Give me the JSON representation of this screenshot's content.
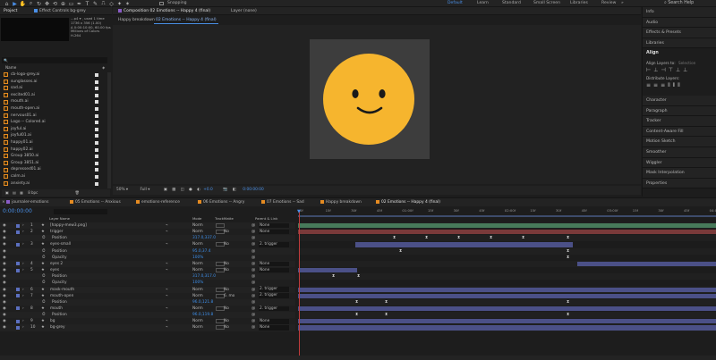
{
  "topbar": {
    "workspaces": [
      "Default",
      "Learn",
      "Standard",
      "Small Screen",
      "Libraries",
      "Review"
    ],
    "active_workspace": "Default",
    "snapping_label": "Snapping",
    "search_label": "Search Help"
  },
  "project": {
    "tab_label": "Project",
    "effect_controls_label": "Effect Controls bg-grey",
    "selected_info": [
      "...p4 ▾ , used 1 time",
      "1736 x 356 (1.00)",
      "Δ 0:00:10:00, 60.00 fps",
      "Millions of Colors",
      "H.264"
    ],
    "search_placeholder": "🔍",
    "col_name": "Name",
    "files": [
      "cb-logo-grey.ai",
      "sunglasses.ai",
      "sad.ai",
      "excited01.ai",
      "mouth.ai",
      "mouth-open.ai",
      "nervous01.ai",
      "Logo -- Colored.ai",
      "joyful.ai",
      "joyful01.ai",
      "happy01.ai",
      "happy02.ai",
      "Group 3850.ai",
      "Group 3851.ai",
      "depressed01.ai",
      "calm.ai",
      "anxiety.ai"
    ],
    "footer_label": "8 bpc"
  },
  "composition": {
    "tab_label": "Composition 02 Emotions -- Happy 4 (final)",
    "layer_tab_label": "Layer (none)",
    "sub_tabs": [
      "Happy breakdown",
      "02 Emotions -- Happy 4 (final)"
    ],
    "zoom": "50%",
    "resolution": "Full",
    "exposure": "+0.0",
    "timecode": "0:00:00:00"
  },
  "right_panel": {
    "items": [
      "Info",
      "Audio",
      "Effects & Presets",
      "Libraries"
    ],
    "align_title": "Align",
    "align_layers_to": "Align Layers to:",
    "align_target": "Selection",
    "distribute_label": "Distribute Layers:",
    "more_items": [
      "Character",
      "Paragraph",
      "Tracker",
      "Content-Aware Fill",
      "Motion Sketch",
      "Smoother",
      "Wiggler",
      "Mask Interpolation",
      "Properties"
    ]
  },
  "timeline": {
    "tabs": [
      "journaler-emotions",
      "05 Emotions -- Anxious",
      "emotions-reference",
      "06 Emotions -- Angry",
      "07 Emotions -- Sad",
      "Happy breakdown",
      "02 Emotions -- Happy 4 (final)"
    ],
    "timecode": "0:00:00:00",
    "col_layer_name": "Layer Name",
    "col_mode": "Mode",
    "col_trkmat": "TrackMatte",
    "col_parent": "Parent & Link",
    "ruler": [
      "0f",
      "15f",
      "30f",
      "45f",
      "01:00f",
      "15f",
      "30f",
      "45f",
      "02:00f",
      "15f",
      "30f",
      "45f",
      "03:00f",
      "15f",
      "30f",
      "45f",
      "04:00f"
    ],
    "layers": [
      {
        "num": "1",
        "name": "[happy-mew3.png]",
        "mode": "Norm",
        "trk": "",
        "parent": "None",
        "kind": "layer"
      },
      {
        "num": "2",
        "name": "trigger",
        "mode": "Norm",
        "trk": "No",
        "parent": "None",
        "kind": "layer"
      },
      {
        "num": "",
        "name": "Position",
        "value": "317.0,337.0",
        "kind": "prop"
      },
      {
        "num": "3",
        "name": "eyes-small",
        "mode": "Norm",
        "trk": "No",
        "parent": "2. trigger",
        "kind": "layer"
      },
      {
        "num": "",
        "name": "Position",
        "value": "95.0,37.4",
        "kind": "prop"
      },
      {
        "num": "",
        "name": "Opacity",
        "value": "100%",
        "kind": "prop"
      },
      {
        "num": "4",
        "name": "eyes 2",
        "mode": "Norm",
        "trk": "No",
        "parent": "None",
        "kind": "layer"
      },
      {
        "num": "5",
        "name": "eyes",
        "mode": "Norm",
        "trk": "No",
        "parent": "None",
        "kind": "layer"
      },
      {
        "num": "",
        "name": "Position",
        "value": "317.0,317.0",
        "kind": "prop"
      },
      {
        "num": "",
        "name": "Opacity",
        "value": "100%",
        "kind": "prop"
      },
      {
        "num": "6",
        "name": "mask-mouth",
        "mode": "Norm",
        "trk": "No",
        "parent": "2. trigger",
        "kind": "layer"
      },
      {
        "num": "7",
        "name": "mouth-open",
        "mode": "Norm",
        "trk": "6. mo",
        "parent": "2. trigger",
        "kind": "layer"
      },
      {
        "num": "",
        "name": "Position",
        "value": "96.0,121.8",
        "kind": "prop"
      },
      {
        "num": "8",
        "name": "mouth",
        "mode": "Norm",
        "trk": "No",
        "parent": "2. trigger",
        "kind": "layer"
      },
      {
        "num": "",
        "name": "Position",
        "value": "96.0,119.8",
        "kind": "prop"
      },
      {
        "num": "9",
        "name": "bg",
        "mode": "Norm",
        "trk": "No",
        "parent": "None",
        "kind": "layer"
      },
      {
        "num": "10",
        "name": "bg-grey",
        "mode": "Norm",
        "trk": "No",
        "parent": "None",
        "kind": "layer"
      }
    ]
  },
  "colors": {
    "accent": "#4a90e8",
    "face": "#f6b52e",
    "comp_bg": "#3d3d3d",
    "layer_bar": "#4b5087",
    "playhead": "#c03b3b"
  }
}
